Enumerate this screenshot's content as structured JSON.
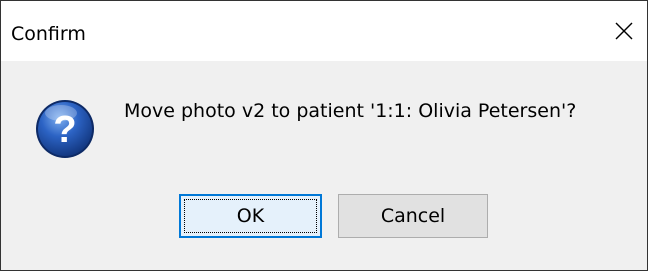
{
  "window": {
    "title": "Confirm",
    "close_icon": "close-icon"
  },
  "dialog": {
    "icon": "question-icon",
    "message": "Move photo v2 to patient '1:1: Olivia Petersen'?"
  },
  "buttons": {
    "ok_label": "OK",
    "cancel_label": "Cancel"
  },
  "colors": {
    "icon_blue": "#1f4fa0",
    "focus_border": "#0078d7"
  }
}
